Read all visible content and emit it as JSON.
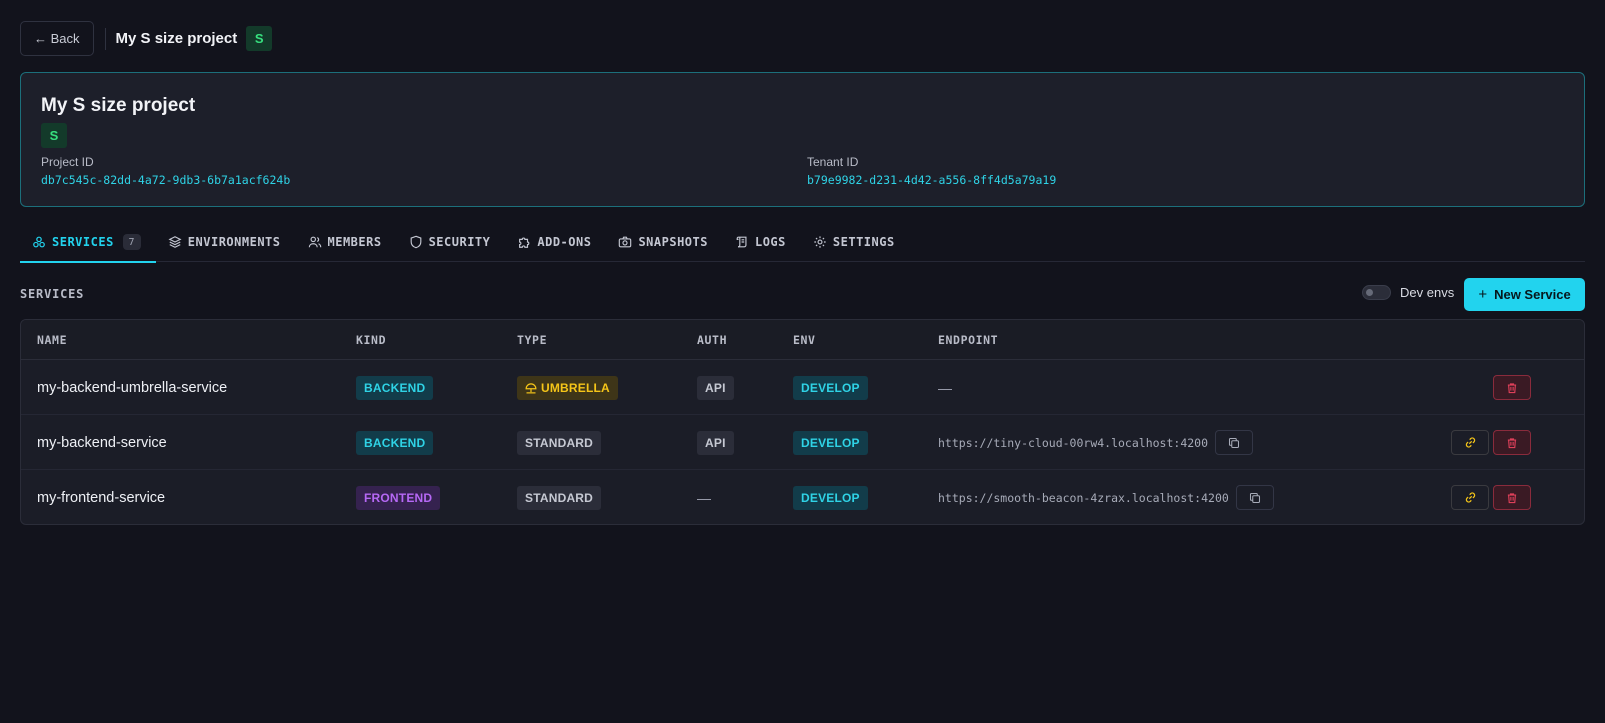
{
  "topbar": {
    "back_label": "← Back",
    "project_title": "My S size project",
    "size_badge": "S"
  },
  "project": {
    "name": "My S size project",
    "size_badge": "S",
    "project_id_label": "Project ID",
    "project_id": "db7c545c-82dd-4a72-9db3-6b7a1acf624b",
    "tenant_id_label": "Tenant ID",
    "tenant_id": "b79e9982-d231-4d42-a556-8ff4d5a79a19"
  },
  "tabs": [
    {
      "label": "SERVICES",
      "count": "7",
      "icon": "services-icon",
      "active": true
    },
    {
      "label": "ENVIRONMENTS",
      "icon": "layers-icon"
    },
    {
      "label": "MEMBERS",
      "icon": "users-icon"
    },
    {
      "label": "SECURITY",
      "icon": "shield-icon"
    },
    {
      "label": "ADD-ONS",
      "icon": "puzzle-icon"
    },
    {
      "label": "SNAPSHOTS",
      "icon": "camera-icon"
    },
    {
      "label": "LOGS",
      "icon": "scroll-icon"
    },
    {
      "label": "SETTINGS",
      "icon": "gear-icon"
    }
  ],
  "services_section": {
    "title": "SERVICES",
    "dev_envs_label": "Dev envs",
    "dev_envs_enabled": false,
    "new_service_label": "New Service"
  },
  "table": {
    "headers": {
      "name": "NAME",
      "kind": "KIND",
      "type": "TYPE",
      "auth": "AUTH",
      "env": "ENV",
      "endpoint": "ENDPOINT"
    },
    "rows": [
      {
        "name": "my-backend-umbrella-service",
        "kind": "BACKEND",
        "type": "UMBRELLA",
        "type_icon": "umbrella-icon",
        "auth": "API",
        "env": "DEVELOP",
        "endpoint": "—"
      },
      {
        "name": "my-backend-service",
        "kind": "BACKEND",
        "type": "STANDARD",
        "auth": "API",
        "env": "DEVELOP",
        "endpoint": "https://tiny-cloud-00rw4.localhost:4200"
      },
      {
        "name": "my-frontend-service",
        "kind": "FRONTEND",
        "type": "STANDARD",
        "auth": "—",
        "env": "DEVELOP",
        "endpoint": "https://smooth-beacon-4zrax.localhost:4200"
      }
    ]
  },
  "colors": {
    "accent": "#22d3ee",
    "background": "#12131c",
    "size_green": "#37e07f",
    "danger": "#e0405a",
    "umbrella": "#f5c518",
    "frontend": "#b668f5"
  }
}
